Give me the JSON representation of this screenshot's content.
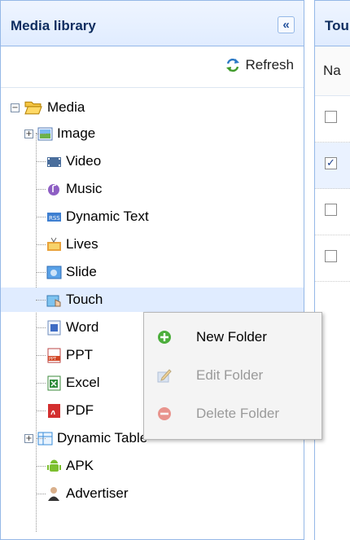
{
  "left_panel": {
    "title": "Media library",
    "collapse_glyph": "«",
    "refresh_label": "Refresh"
  },
  "tree": {
    "root": "Media",
    "items": [
      {
        "label": "Image",
        "icon": "image-icon",
        "expandable": true
      },
      {
        "label": "Video",
        "icon": "video-icon"
      },
      {
        "label": "Music",
        "icon": "music-icon"
      },
      {
        "label": "Dynamic Text",
        "icon": "dynamic-text-icon"
      },
      {
        "label": "Lives",
        "icon": "tv-icon"
      },
      {
        "label": "Slide",
        "icon": "slide-icon"
      },
      {
        "label": "Touch",
        "icon": "touch-icon",
        "selected": true
      },
      {
        "label": "Word",
        "icon": "word-icon"
      },
      {
        "label": "PPT",
        "icon": "ppt-icon"
      },
      {
        "label": "Excel",
        "icon": "excel-icon"
      },
      {
        "label": "PDF",
        "icon": "pdf-icon"
      },
      {
        "label": "Dynamic Table",
        "icon": "table-icon",
        "expandable": true
      },
      {
        "label": "APK",
        "icon": "android-icon"
      },
      {
        "label": "Advertiser",
        "icon": "person-icon"
      }
    ]
  },
  "right_panel": {
    "title": "Tou",
    "column_label": "Na",
    "rows": [
      false,
      true,
      false,
      false
    ]
  },
  "context_menu": {
    "items": [
      {
        "label": "New Folder",
        "enabled": true
      },
      {
        "label": "Edit Folder",
        "enabled": false
      },
      {
        "label": "Delete Folder",
        "enabled": false
      }
    ]
  },
  "colors": {
    "border": "#95b8e7",
    "header": "#e0ecff",
    "selection": "#e0ecff"
  }
}
